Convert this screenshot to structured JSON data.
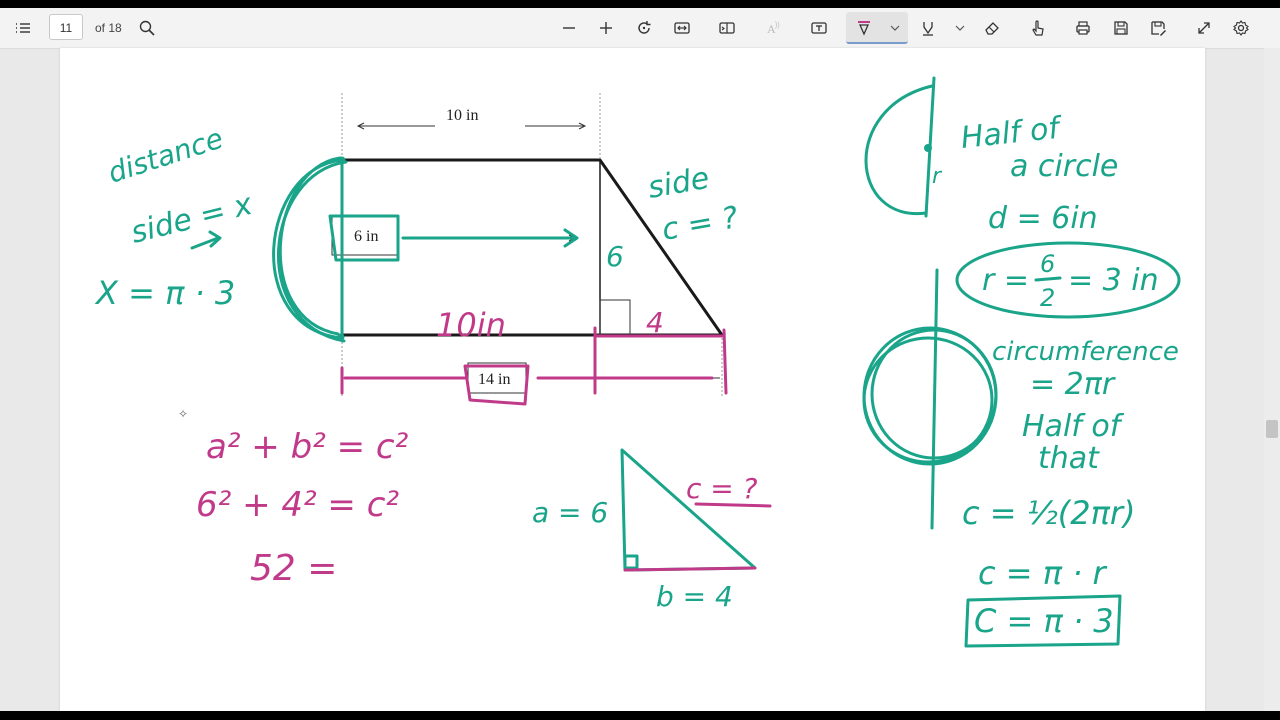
{
  "toolbar": {
    "page_number": "11",
    "page_total": "of 18",
    "icons": [
      "list-icon",
      "search-icon",
      "zoom-out-icon",
      "zoom-in-icon",
      "rotate-icon",
      "fit-width-icon",
      "page-view-icon",
      "read-aloud-icon",
      "text-box-icon",
      "draw-icon",
      "chevron-down-icon",
      "highlight-icon",
      "chevron-down-icon",
      "eraser-icon",
      "touch-icon",
      "print-icon",
      "save-icon",
      "save-as-icon",
      "fullscreen-icon",
      "settings-icon"
    ]
  },
  "figure": {
    "top_dim": "10 in",
    "height_dim": "6 in",
    "bottom_dim": "14 in"
  },
  "ink": {
    "distance": "distance",
    "side_eq_x": "side = x",
    "x_eq": "X = π · 3",
    "six": "6",
    "ten_in": "10in",
    "four": "4",
    "side": "side",
    "c_q": "c = ?",
    "eq1": "a² + b² = c²",
    "eq2": "6² + 4² = c²",
    "eq3": "52 =",
    "tri_a": "a = 6",
    "tri_c": "c = ?",
    "tri_b": "b = 4",
    "half_of": "Half of",
    "a_circle": "a circle",
    "r_label": "r",
    "d_eq": "d = 6in",
    "r_eq": "r = 6/2 = 3 in",
    "r_num": "6",
    "r_den": "2",
    "r_rest": "= 3 in",
    "r_lhs": "r =",
    "circumference": "circumference",
    "two_pi_r": "= 2πr",
    "half_of_that_1": "Half of",
    "half_of_that_2": "that",
    "c_half": "c = ½(2πr)",
    "c_pir": "c = π · r",
    "c_final": "C = π · 3"
  }
}
